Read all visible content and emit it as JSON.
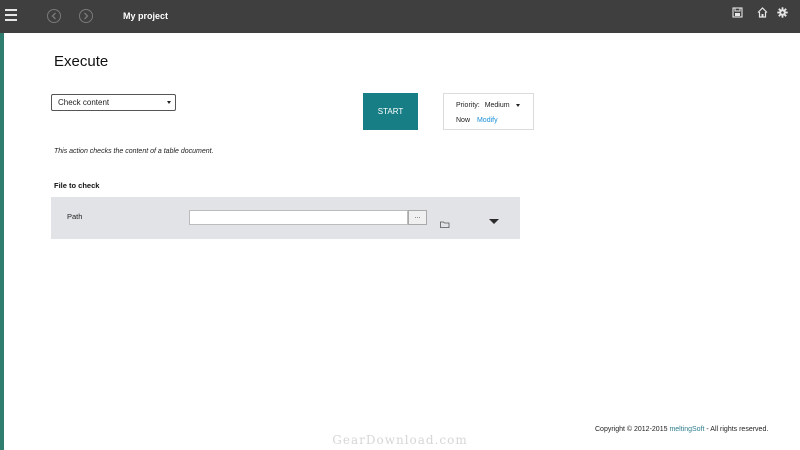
{
  "app": {
    "project_title": "My project"
  },
  "topbar": {
    "icons": [
      "hamburger-menu-icon",
      "back-icon",
      "forward-icon",
      "save-icon",
      "home-icon",
      "gear-icon"
    ]
  },
  "page": {
    "title": "Execute"
  },
  "action_select": {
    "value": "Check content"
  },
  "start_button": {
    "label": "START"
  },
  "priority": {
    "label": "Priority:",
    "value": "Medium",
    "when": "Now",
    "modify_label": "Modify"
  },
  "description": "This action checks the content of a table document.",
  "file_section": {
    "title": "File to check",
    "path_label": "Path",
    "path_value": "",
    "browse_label": "..."
  },
  "footer": {
    "copyright": "Copyright © 2012-2015",
    "brand": "meltingSoft",
    "rights": "- All rights reserved."
  },
  "watermark": "GearDownload.com",
  "colors": {
    "topbar": "#3f3f3f",
    "accent": "#177e85",
    "left_strip": "#2e7d6f",
    "panel_bg": "#e1e3e6",
    "link": "#1a8fd8"
  }
}
